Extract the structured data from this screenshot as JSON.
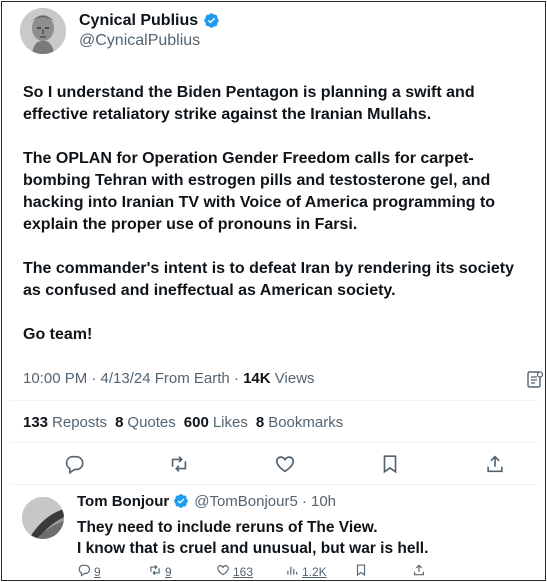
{
  "tweet": {
    "author_name": "Cynical Publius",
    "author_handle": "@CynicalPublius",
    "paragraphs": [
      "So I understand the Biden Pentagon is planning a swift and effective retaliatory strike against the Iranian Mullahs.",
      "The OPLAN for Operation Gender Freedom calls for carpet-bombing Tehran with estrogen pills and testosterone gel, and hacking into Iranian TV with Voice of America programming to explain the proper use of pronouns in Farsi.",
      "The commander's intent is to defeat Iran by rendering its society as confused and ineffectual as American society.",
      "Go team!"
    ],
    "meta_time": "10:00 PM · 4/13/24 From Earth · ",
    "meta_views_count": "14K",
    "meta_views_label": " Views",
    "stats": {
      "reposts_count": "133",
      "reposts_label": "Reposts",
      "quotes_count": "8",
      "quotes_label": "Quotes",
      "likes_count": "600",
      "likes_label": "Likes",
      "bookmarks_count": "8",
      "bookmarks_label": "Bookmarks"
    }
  },
  "reply": {
    "author_name": "Tom Bonjour",
    "author_handle": "@TomBonjour5",
    "time": "· 10h",
    "lines": [
      "They need to include reruns of The View.",
      "I know that is cruel and unusual, but war is hell."
    ],
    "replies": "9",
    "reposts": "9",
    "likes": "163",
    "views": "1.2K"
  },
  "colors": {
    "text": "#0f1419",
    "secondary": "#536471",
    "verified": "#1d9bf0",
    "divider": "#eff3f4"
  },
  "icons": [
    "verified-badge-icon",
    "grok-icon",
    "reply-icon",
    "repost-icon",
    "like-icon",
    "bookmark-icon",
    "share-icon",
    "views-icon"
  ]
}
